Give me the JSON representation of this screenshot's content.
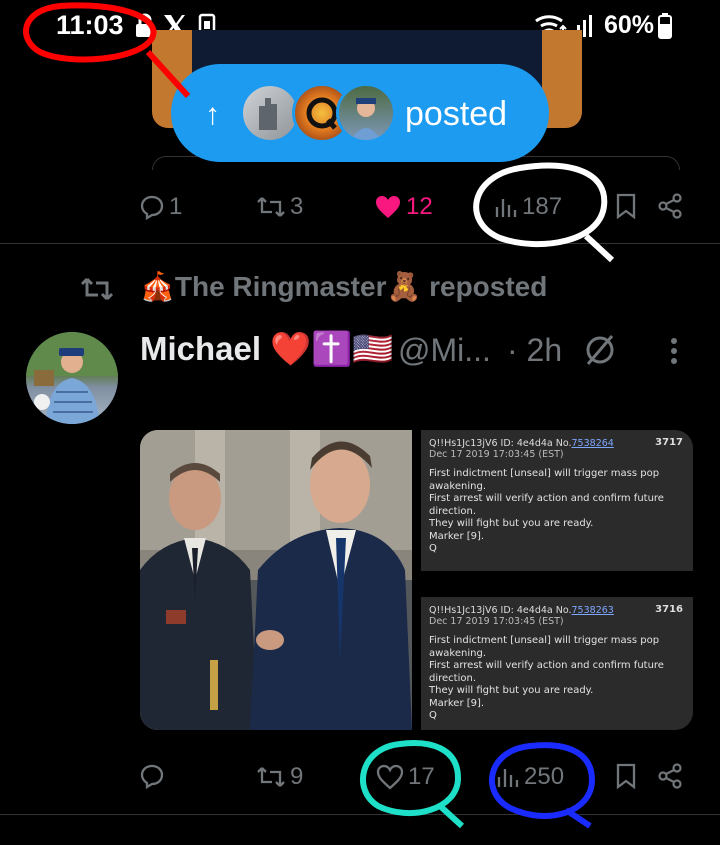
{
  "status_bar": {
    "time": "11:03",
    "battery": "60%",
    "icons": [
      "lock-icon",
      "x-logo-icon",
      "sim-icon",
      "wifi-icon",
      "signal-icon",
      "battery-icon"
    ]
  },
  "new_posts_pill": {
    "label": "posted",
    "arrow_icon": "arrow-up-icon"
  },
  "prev_tweet_actions": {
    "replies": "1",
    "reposts": "3",
    "likes": "12",
    "views": "187",
    "liked": true
  },
  "tweet": {
    "repost_by": "🎪The Ringmaster🧸 reposted",
    "author_name": "Michael ❤️✝️🇺🇸",
    "handle": "@Mi...",
    "time": "· 2h",
    "q_posts": [
      {
        "header": "Q!!Hs1Jc13jV6 ID: 4e4d4a No.",
        "number_link": "7538264",
        "post_number": "3717",
        "date": "Dec 17 2019 17:03:45 (EST)",
        "body": "First indictment [unseal] will trigger mass pop awakening.\nFirst arrest will verify action and confirm future direction.\nThey will fight but you are ready.\nMarker [9].\nQ"
      },
      {
        "header": "Q!!Hs1Jc13jV6 ID: 4e4d4a No.",
        "number_link": "7538263",
        "post_number": "3716",
        "date": "Dec 17 2019 17:03:45 (EST)",
        "body": "First indictment [unseal] will trigger mass pop awakening.\nFirst arrest will verify action and confirm future direction.\nThey will fight but you are ready.\nMarker [9].\nQ"
      }
    ],
    "actions": {
      "replies": "",
      "reposts": "9",
      "likes": "17",
      "views": "250"
    }
  },
  "annotation_colors": {
    "red": "#ff0000",
    "white": "#ffffff",
    "cyan": "#1ee0c8",
    "blue": "#1a2bff"
  }
}
